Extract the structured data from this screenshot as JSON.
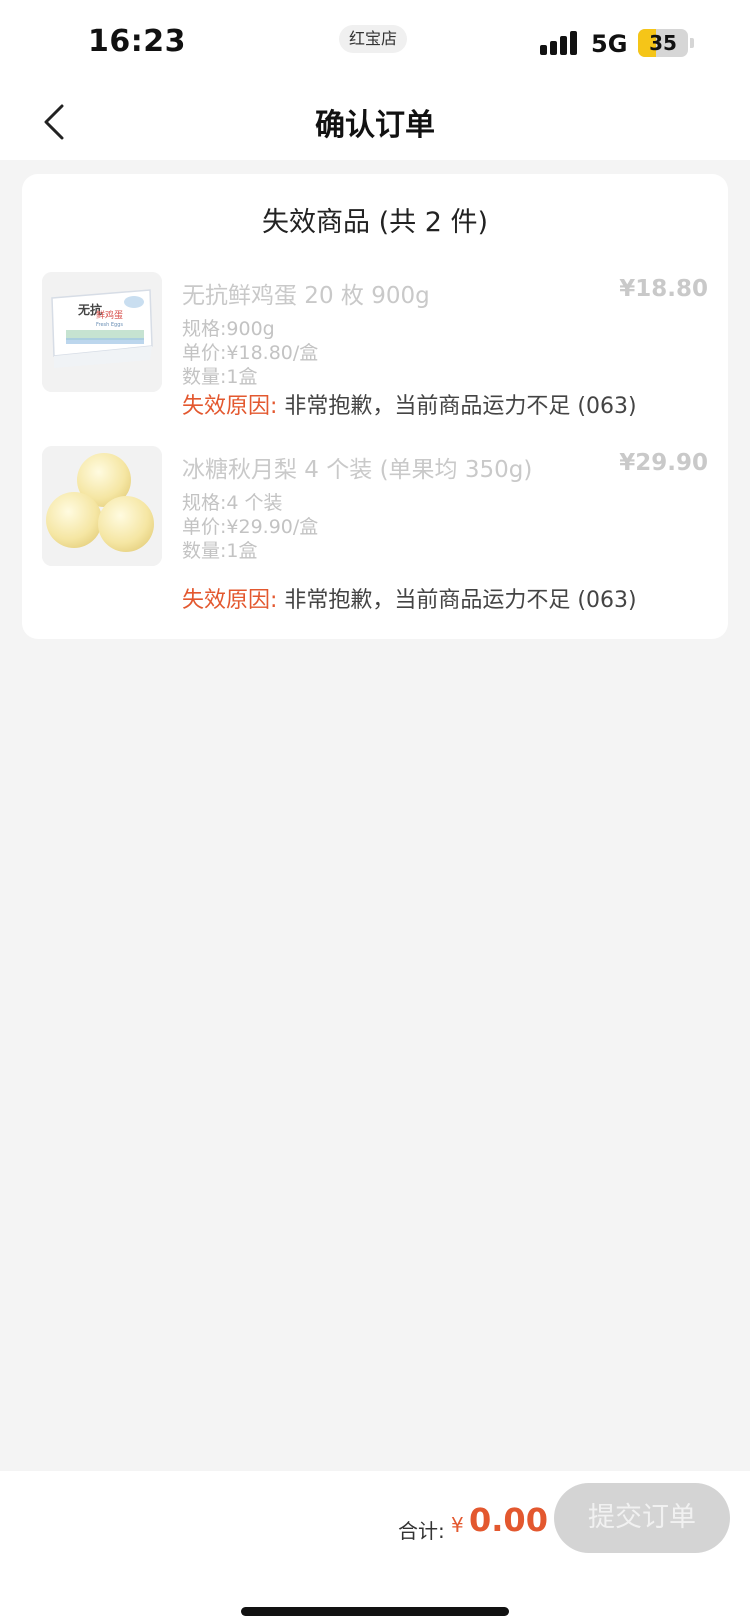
{
  "status_bar": {
    "time": "16:23",
    "center_label": "红宝店",
    "network": "5G",
    "battery": "35",
    "battery_level": 0.35
  },
  "header": {
    "title": "确认订单"
  },
  "invalid_section": {
    "title": "失效商品 (共 2 件)",
    "items": [
      {
        "name": "无抗鲜鸡蛋 20 枚 900g",
        "price": "¥18.80",
        "spec": "规格:900g",
        "unit_price": "单价:¥18.80/盒",
        "quantity": "数量:1盒",
        "reason_label": "失效原因:",
        "reason_text": "非常抱歉，当前商品运力不足 (063)",
        "image_text_1": "无抗",
        "image_text_2": "鲜鸡蛋",
        "image_text_3": "Fresh Eggs"
      },
      {
        "name": "冰糖秋月梨 4 个装 (单果均 350g)",
        "price": "¥29.90",
        "spec": "规格:4 个装",
        "unit_price": "单价:¥29.90/盒",
        "quantity": "数量:1盒",
        "reason_label": "失效原因:",
        "reason_text": "非常抱歉，当前商品运力不足 (063)"
      }
    ]
  },
  "footer": {
    "total_label": "合计:",
    "currency": "¥",
    "total_value": "0.00",
    "submit_label": "提交订单"
  },
  "colors": {
    "accent": "#e3582f",
    "background": "#f4f4f4",
    "disabled_button": "#d4d4d4"
  }
}
